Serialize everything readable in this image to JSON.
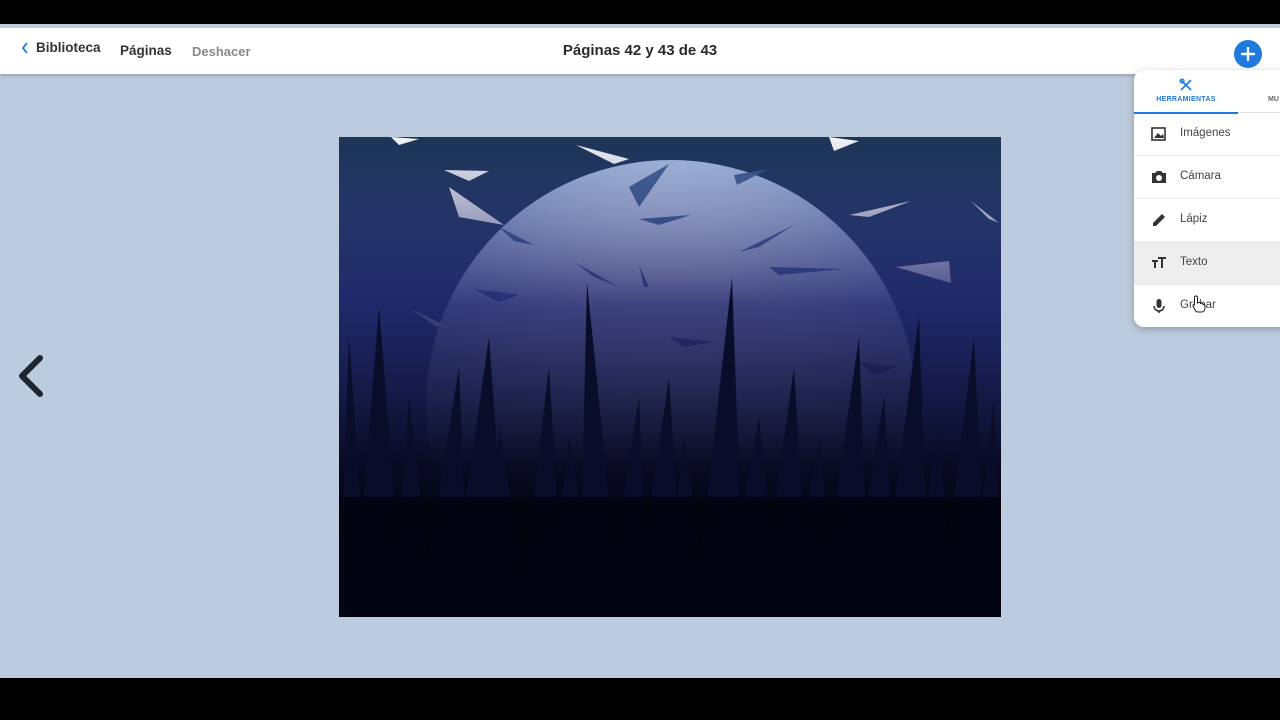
{
  "header": {
    "back_label": "Biblioteca",
    "pages_label": "Páginas",
    "undo_label": "Deshacer",
    "title": "Páginas 42 y 43 de 43"
  },
  "colors": {
    "accent": "#1f7ae0",
    "canvas_background": "#bdcbdf"
  },
  "icons": {
    "back": "chevron-left-icon",
    "add": "plus-icon",
    "previous_page": "chevron-left-icon",
    "tools_tab": "tools-icon"
  },
  "tools_panel": {
    "tabs": [
      {
        "label": "HERRAMIENTAS",
        "active": true
      },
      {
        "label": "MU",
        "active": false
      }
    ],
    "items": [
      {
        "label": "Imágenes",
        "icon": "image-icon"
      },
      {
        "label": "Cámara",
        "icon": "camera-icon"
      },
      {
        "label": "Lápiz",
        "icon": "pencil-icon"
      },
      {
        "label": "Texto",
        "icon": "text-icon",
        "hovered": true
      },
      {
        "label": "Grabar",
        "icon": "microphone-icon"
      }
    ]
  },
  "page_image": {
    "description_icon": "moon-night-grass-illustration"
  }
}
